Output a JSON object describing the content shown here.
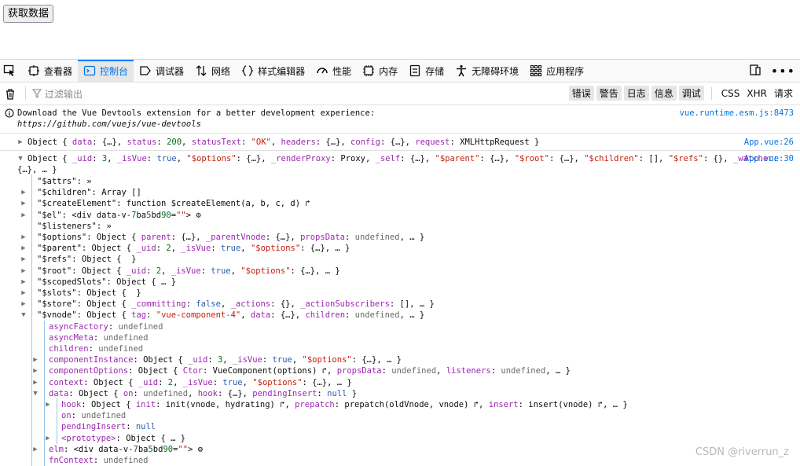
{
  "page": {
    "fetch_button": "获取数据"
  },
  "toolbar": {
    "tabs": [
      {
        "label": "查看器",
        "icon": "inspector-icon"
      },
      {
        "label": "控制台",
        "icon": "console-icon",
        "active": true
      },
      {
        "label": "调试器",
        "icon": "debugger-icon"
      },
      {
        "label": "网络",
        "icon": "network-icon"
      },
      {
        "label": "样式编辑器",
        "icon": "style-editor-icon"
      },
      {
        "label": "性能",
        "icon": "performance-icon"
      },
      {
        "label": "内存",
        "icon": "memory-icon"
      },
      {
        "label": "存储",
        "icon": "storage-icon"
      },
      {
        "label": "无障碍环境",
        "icon": "accessibility-icon"
      },
      {
        "label": "应用程序",
        "icon": "application-icon"
      }
    ]
  },
  "filter": {
    "placeholder": "过滤输出",
    "levels": [
      "错误",
      "警告",
      "日志",
      "信息",
      "调试"
    ],
    "types": [
      "CSS",
      "XHR",
      "请求"
    ]
  },
  "console": {
    "warn": {
      "text1": "Download the Vue Devtools extension for a better development experience:",
      "text2": "https://github.com/vuejs/vue-devtools",
      "source": "vue.runtime.esm.js:8473"
    },
    "log1": {
      "text": "Object { data: {…}, status: 200, statusText: \"OK\", headers: {…}, config: {…}, request: XMLHttpRequest }",
      "source": "App.vue:26"
    },
    "log2": {
      "text": "Object { _uid: 3, _isVue: true, \"$options\": {…}, _renderProxy: Proxy, _self: {…}, \"$parent\": {…}, \"$root\": {…}, \"$children\": [], \"$refs\": {}, _watcher:",
      "text_cont": "{…}, … }",
      "source": "App.vue:30"
    },
    "props": [
      {
        "d": 1,
        "tw": "",
        "key": "\"$attrs\"",
        "val": ": »"
      },
      {
        "d": 1,
        "tw": "▶",
        "key": "\"$children\"",
        "val": ": Array []"
      },
      {
        "d": 1,
        "tw": "▶",
        "key": "\"$createElement\"",
        "val": ": function $createElement(a, b, c, d) ↱"
      },
      {
        "d": 1,
        "tw": "▶",
        "key": "\"$el\"",
        "val": ": <div data-v-7ba5bd90=\"\"> ⚙"
      },
      {
        "d": 1,
        "tw": "",
        "key": "\"$listeners\"",
        "val": ": »"
      },
      {
        "d": 1,
        "tw": "▶",
        "key": "\"$options\"",
        "val": ": Object { parent: {…}, _parentVnode: {…}, propsData: undefined, … }"
      },
      {
        "d": 1,
        "tw": "▶",
        "key": "\"$parent\"",
        "val": ": Object { _uid: 2, _isVue: true, \"$options\": {…}, … }"
      },
      {
        "d": 1,
        "tw": "▶",
        "key": "\"$refs\"",
        "val": ": Object {  }"
      },
      {
        "d": 1,
        "tw": "▶",
        "key": "\"$root\"",
        "val": ": Object { _uid: 2, _isVue: true, \"$options\": {…}, … }"
      },
      {
        "d": 1,
        "tw": "▶",
        "key": "\"$scopedSlots\"",
        "val": ": Object { … }"
      },
      {
        "d": 1,
        "tw": "▶",
        "key": "\"$slots\"",
        "val": ": Object {  }"
      },
      {
        "d": 1,
        "tw": "▶",
        "key": "\"$store\"",
        "val": ": Object { _committing: false, _actions: {}, _actionSubscribers: [], … }"
      },
      {
        "d": 1,
        "tw": "▼",
        "key": "\"$vnode\"",
        "val": ": Object { tag: \"vue-component-4\", data: {…}, children: undefined, … }"
      },
      {
        "d": 2,
        "tw": "",
        "key": "asyncFactory",
        "val": ": undefined"
      },
      {
        "d": 2,
        "tw": "",
        "key": "asyncMeta",
        "val": ": undefined"
      },
      {
        "d": 2,
        "tw": "",
        "key": "children",
        "val": ": undefined"
      },
      {
        "d": 2,
        "tw": "▶",
        "key": "componentInstance",
        "val": ": Object { _uid: 3, _isVue: true, \"$options\": {…}, … }"
      },
      {
        "d": 2,
        "tw": "▶",
        "key": "componentOptions",
        "val": ": Object { Ctor: VueComponent(options) ↱, propsData: undefined, listeners: undefined, … }"
      },
      {
        "d": 2,
        "tw": "▶",
        "key": "context",
        "val": ": Object { _uid: 2, _isVue: true, \"$options\": {…}, … }"
      },
      {
        "d": 2,
        "tw": "▼",
        "key": "data",
        "val": ": Object { on: undefined, hook: {…}, pendingInsert: null }"
      },
      {
        "d": 3,
        "tw": "▶",
        "key": "hook",
        "val": ": Object { init: init(vnode, hydrating) ↱, prepatch: prepatch(oldVnode, vnode) ↱, insert: insert(vnode) ↱, … }"
      },
      {
        "d": 3,
        "tw": "",
        "key": "on",
        "val": ": undefined"
      },
      {
        "d": 3,
        "tw": "",
        "key": "pendingInsert",
        "val": ": null"
      },
      {
        "d": 3,
        "tw": "▶",
        "key": "<prototype>",
        "val": ": Object { … }"
      },
      {
        "d": 2,
        "tw": "▶",
        "key": "elm",
        "val": ": <div data-v-7ba5bd90=\"\"> ⚙"
      },
      {
        "d": 2,
        "tw": "",
        "key": "fnContext",
        "val": ": undefined"
      }
    ]
  },
  "watermark": "CSDN @riverrun_z"
}
